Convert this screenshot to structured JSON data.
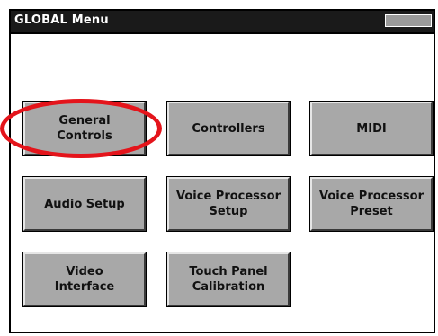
{
  "window": {
    "title": "GLOBAL Menu"
  },
  "buttons": {
    "general_controls": "General\nControls",
    "controllers": "Controllers",
    "midi": "MIDI",
    "audio_setup": "Audio Setup",
    "voice_processor_setup": "Voice Processor\nSetup",
    "voice_processor_preset": "Voice Processor\nPreset",
    "video_interface": "Video\nInterface",
    "touch_panel_calibration": "Touch Panel\nCalibration"
  },
  "annotation": {
    "highlight_color": "#e4141b",
    "highlight_target": "general_controls"
  },
  "colors": {
    "titlebar": "#1a1a1a",
    "button_face": "#a8a8a8"
  }
}
